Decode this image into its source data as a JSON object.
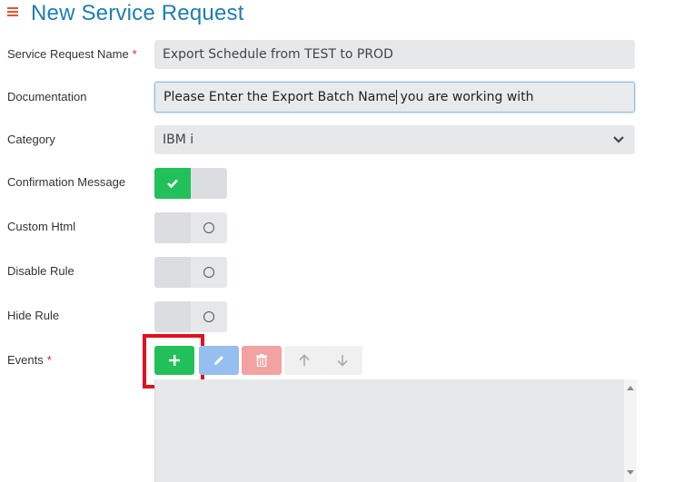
{
  "header": {
    "menu_icon": "hamburger-icon",
    "title": "New Service Request"
  },
  "form": {
    "name": {
      "label": "Service Request Name",
      "required_mark": "*",
      "value": "Export Schedule from TEST to PROD"
    },
    "documentation": {
      "label": "Documentation",
      "value_before_caret": "Please Enter the Export Batch Name",
      "value_after_caret": "you are working with"
    },
    "category": {
      "label": "Category",
      "value": "IBM i"
    },
    "confirmation_message": {
      "label": "Confirmation Message",
      "checked": true
    },
    "custom_html": {
      "label": "Custom Html",
      "checked": false
    },
    "disable_rule": {
      "label": "Disable Rule",
      "checked": false
    },
    "hide_rule": {
      "label": "Hide Rule",
      "checked": false
    },
    "events": {
      "label": "Events",
      "required_mark": "*"
    }
  },
  "colors": {
    "accent_title": "#1b7eb6",
    "required": "#e02020",
    "success": "#22c05a",
    "highlight": "#e2111f"
  },
  "icons": [
    "hamburger-icon",
    "chevron-down-icon",
    "check-icon",
    "plus-icon",
    "pencil-icon",
    "trash-icon",
    "arrow-up-icon",
    "arrow-down-icon"
  ]
}
